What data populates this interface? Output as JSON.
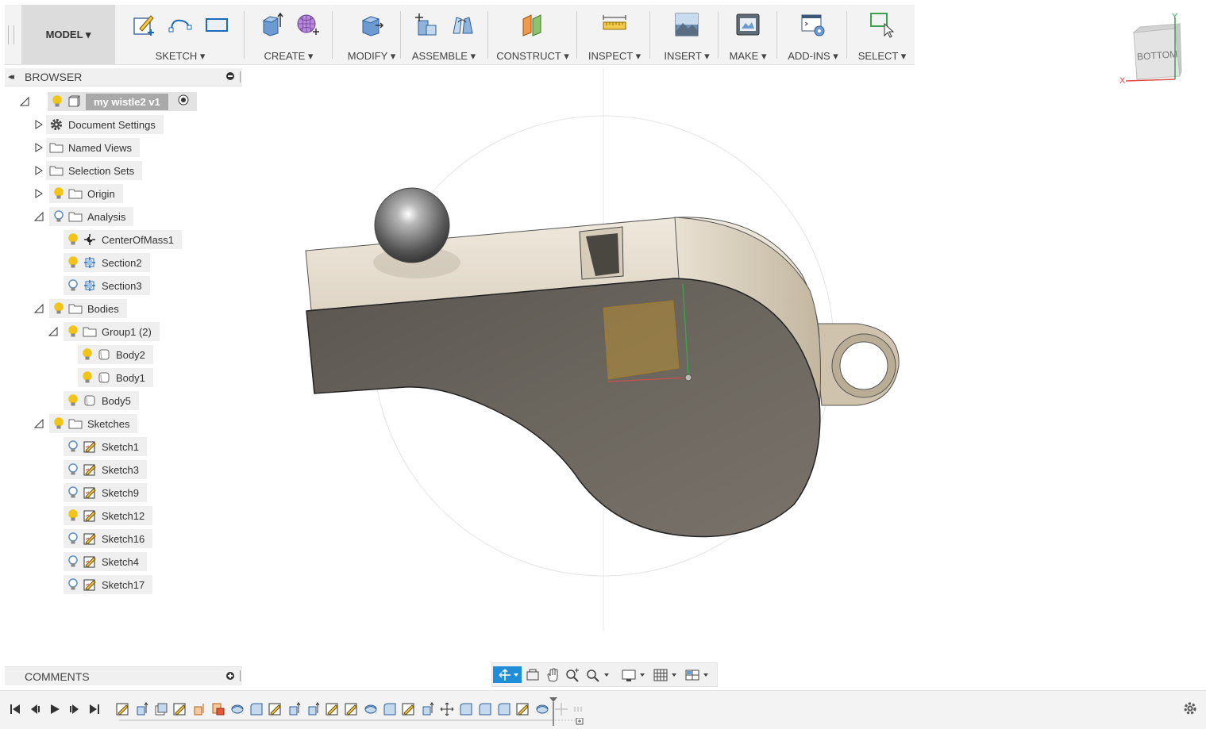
{
  "toolbar": {
    "workspace": "MODEL ▾",
    "groups": [
      {
        "label": "SKETCH ▾"
      },
      {
        "label": "CREATE ▾"
      },
      {
        "label": "MODIFY ▾"
      },
      {
        "label": "ASSEMBLE ▾"
      },
      {
        "label": "CONSTRUCT ▾"
      },
      {
        "label": "INSPECT ▾"
      },
      {
        "label": "INSERT ▾"
      },
      {
        "label": "MAKE ▾"
      },
      {
        "label": "ADD-INS ▾"
      },
      {
        "label": "SELECT ▾"
      }
    ]
  },
  "viewcube": {
    "face": "BOTTOM",
    "axis_x": "X",
    "axis_y": "Y"
  },
  "browser": {
    "title": "BROWSER",
    "root": "my wistle2 v1",
    "items": [
      {
        "label": "Document Settings",
        "icon": "gear-icon"
      },
      {
        "label": "Named Views",
        "icon": "folder-icon"
      },
      {
        "label": "Selection Sets",
        "icon": "folder-icon"
      },
      {
        "label": "Origin",
        "icon": "folder-icon"
      },
      {
        "label": "Analysis",
        "icon": "folder-icon"
      },
      {
        "label": "CenterOfMass1",
        "icon": "center-of-mass-icon"
      },
      {
        "label": "Section2",
        "icon": "section-icon"
      },
      {
        "label": "Section3",
        "icon": "section-icon"
      },
      {
        "label": "Bodies",
        "icon": "folder-icon"
      },
      {
        "label": "Group1 (2)",
        "icon": "folder-icon"
      },
      {
        "label": "Body2",
        "icon": "body-icon"
      },
      {
        "label": "Body1",
        "icon": "body-icon"
      },
      {
        "label": "Body5",
        "icon": "body-icon"
      },
      {
        "label": "Sketches",
        "icon": "folder-icon"
      },
      {
        "label": "Sketch1",
        "icon": "sketch-icon"
      },
      {
        "label": "Sketch3",
        "icon": "sketch-icon"
      },
      {
        "label": "Sketch9",
        "icon": "sketch-icon"
      },
      {
        "label": "Sketch12",
        "icon": "sketch-icon"
      },
      {
        "label": "Sketch16",
        "icon": "sketch-icon"
      },
      {
        "label": "Sketch4",
        "icon": "sketch-icon"
      },
      {
        "label": "Sketch17",
        "icon": "sketch-icon"
      }
    ]
  },
  "comments": {
    "title": "COMMENTS"
  },
  "colors": {
    "accent": "#1e8ed8",
    "bulb_on": "#f0c419",
    "bulb_off": "#5b8fc6"
  }
}
